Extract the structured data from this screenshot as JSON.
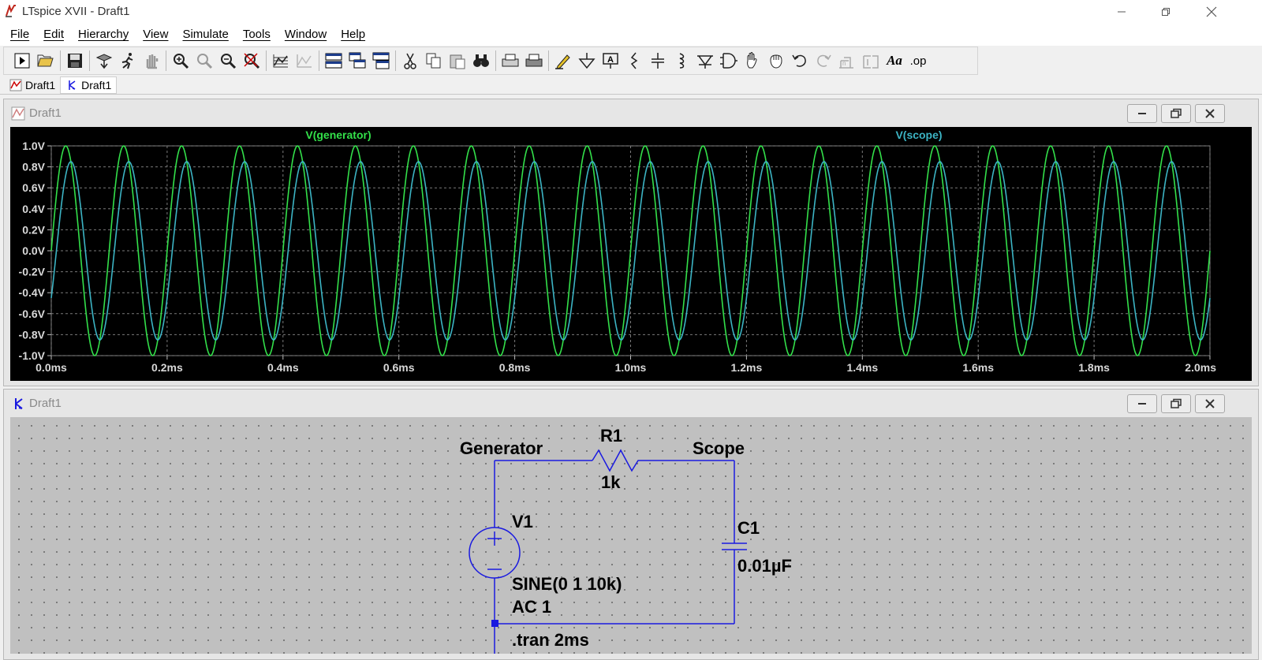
{
  "window": {
    "title": "LTspice XVII - Draft1"
  },
  "menu": [
    "File",
    "Edit",
    "Hierarchy",
    "View",
    "Simulate",
    "Tools",
    "Window",
    "Help"
  ],
  "toolbar": {
    "icons": [
      "new-schematic-icon",
      "open-icon",
      "save-icon",
      "control-panel-icon",
      "run-icon",
      "halt-icon",
      "zoom-area-icon",
      "zoom-full-icon",
      "zoom-out-icon",
      "zoom-fit-icon",
      "autorange-icon",
      "waveform-icon",
      "tile-horizontal-icon",
      "cascade-icon",
      "tile-vertical-icon",
      "cut-icon",
      "copy-icon",
      "paste-icon",
      "find-icon",
      "print-preview-icon",
      "print-icon",
      "draw-wire-icon",
      "ground-icon",
      "label-net-icon",
      "resistor-icon",
      "capacitor-icon",
      "inductor-icon",
      "diode-icon",
      "component-icon",
      "move-icon",
      "drag-icon",
      "undo-icon",
      "redo-icon",
      "rotate-icon",
      "mirror-icon",
      "text-icon",
      "spice-directive-icon"
    ],
    "text_label": "Aa",
    "spice_label": ".op"
  },
  "tabs": [
    {
      "label": "Draft1",
      "icon": "waveform-icon",
      "active": false
    },
    {
      "label": "Draft1",
      "icon": "schematic-icon",
      "active": true
    }
  ],
  "waveform_window": {
    "title": "Draft1"
  },
  "schematic_window": {
    "title": "Draft1"
  },
  "chart_data": {
    "type": "line",
    "background": "#000000",
    "xlim": [
      0,
      2.0
    ],
    "x_unit": "ms",
    "ylim": [
      -1.0,
      1.0
    ],
    "grid": true,
    "x_ticks": [
      "0.0ms",
      "0.2ms",
      "0.4ms",
      "0.6ms",
      "0.8ms",
      "1.0ms",
      "1.2ms",
      "1.4ms",
      "1.6ms",
      "1.8ms",
      "2.0ms"
    ],
    "y_ticks": [
      "1.0V",
      "0.8V",
      "0.6V",
      "0.4V",
      "0.2V",
      "0.0V",
      "-0.2V",
      "-0.4V",
      "-0.6V",
      "-0.8V",
      "-1.0V"
    ],
    "series": [
      {
        "name": "V(generator)",
        "color": "#33e04a",
        "frequency_khz": 10,
        "amplitude": 1.0,
        "phase_deg": 0
      },
      {
        "name": "V(scope)",
        "color": "#3cb4c4",
        "frequency_khz": 10,
        "amplitude": 0.85,
        "phase_deg": -32
      }
    ]
  },
  "schematic": {
    "wire_color": "#1a1ae0",
    "labels": {
      "net_generator": "Generator",
      "net_scope": "Scope",
      "r1_name": "R1",
      "r1_value": "1k",
      "v1_name": "V1",
      "v1_value1": "SINE(0 1 10k)",
      "v1_value2": "AC 1",
      "c1_name": "C1",
      "c1_value": "0.01µF",
      "directive": ".tran 2ms"
    }
  }
}
